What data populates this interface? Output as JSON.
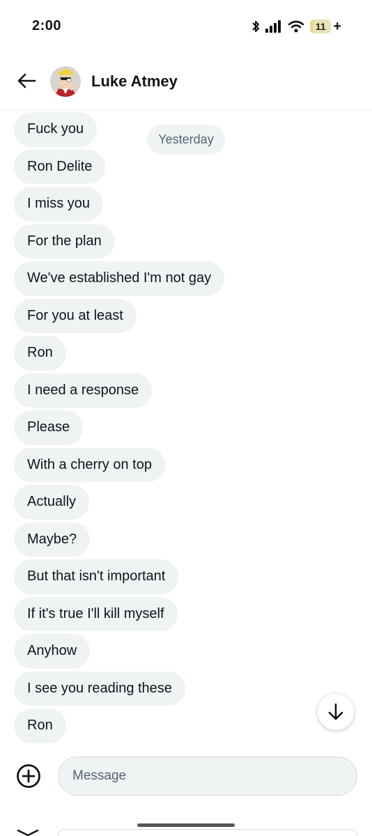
{
  "status_bar": {
    "time": "2:00",
    "battery_level": "11",
    "battery_plus": "+",
    "battery_fraction": 0.11,
    "icons": [
      "bluetooth-icon",
      "signal-icon",
      "wifi-icon",
      "battery-icon"
    ]
  },
  "header": {
    "contact_name": "Luke Atmey",
    "icons": [
      "back-arrow-icon",
      "avatar"
    ]
  },
  "conversation": {
    "date_label": "Yesterday",
    "messages": [
      "Fuck you",
      "Ron Delite",
      "I miss you",
      "For the plan",
      "We've established I'm not gay",
      "For you at least",
      "Ron",
      "I need a response",
      "Please",
      "With a cherry on top",
      "Actually",
      "Maybe?",
      "But that isn't important",
      "If it's true I'll kill myself",
      "Anyhow",
      "I see you reading these",
      "Ron"
    ]
  },
  "composer": {
    "placeholder": "Message",
    "value": "",
    "icons": [
      "add-circle-icon",
      "scroll-down-arrow-icon"
    ]
  },
  "colors": {
    "bubble_bg": "#eff3f4",
    "text": "#0f1419",
    "secondary_text": "#536471",
    "battery": "#e3d98a"
  }
}
